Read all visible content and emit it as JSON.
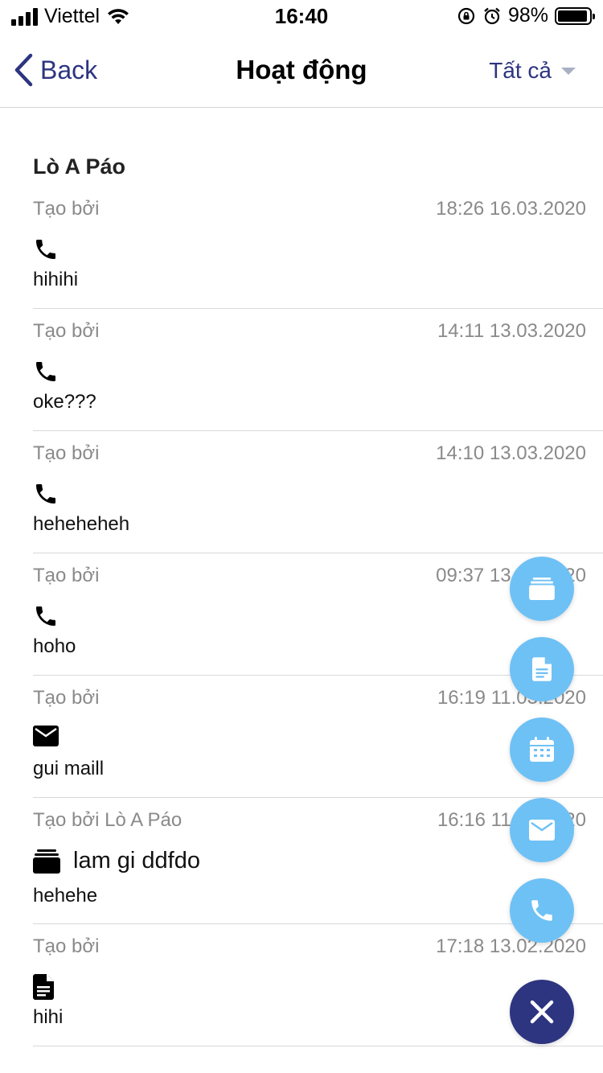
{
  "status_bar": {
    "carrier": "Viettel",
    "time": "16:40",
    "battery": "98%"
  },
  "nav": {
    "back_label": "Back",
    "title": "Hoạt động",
    "filter_label": "Tất cả"
  },
  "owner_name": "Lò A Páo",
  "activities": [
    {
      "creator": "Tạo bởi",
      "time": "18:26 16.03.2020",
      "icon": "phone-icon",
      "subject": "",
      "note": "hihihi"
    },
    {
      "creator": "Tạo bởi",
      "time": "14:11 13.03.2020",
      "icon": "phone-icon",
      "subject": "",
      "note": "oke???"
    },
    {
      "creator": "Tạo bởi",
      "time": "14:10 13.03.2020",
      "icon": "phone-icon",
      "subject": "",
      "note": "heheheheh"
    },
    {
      "creator": "Tạo bởi",
      "time": "09:37 13.03.2020",
      "icon": "phone-icon",
      "subject": "",
      "note": "hoho"
    },
    {
      "creator": "Tạo bởi",
      "time": "16:19 11.03.2020",
      "icon": "mail-icon",
      "subject": "",
      "note": "gui maill"
    },
    {
      "creator": "Tạo bởi Lò A Páo",
      "time": "16:16 11.03.2020",
      "icon": "inbox-stack-icon",
      "subject": "lam gi ddfdo",
      "note": "hehehe"
    },
    {
      "creator": "Tạo bởi",
      "time": "17:18 13.02.2020",
      "icon": "document-icon",
      "subject": "",
      "note": "hihi"
    }
  ],
  "fab_menu": {
    "items": [
      "inbox-stack-icon",
      "document-icon",
      "calendar-icon",
      "mail-icon",
      "phone-icon"
    ],
    "close": "close-icon",
    "accent_color": "#6ec1f5",
    "close_color": "#2d3480"
  }
}
